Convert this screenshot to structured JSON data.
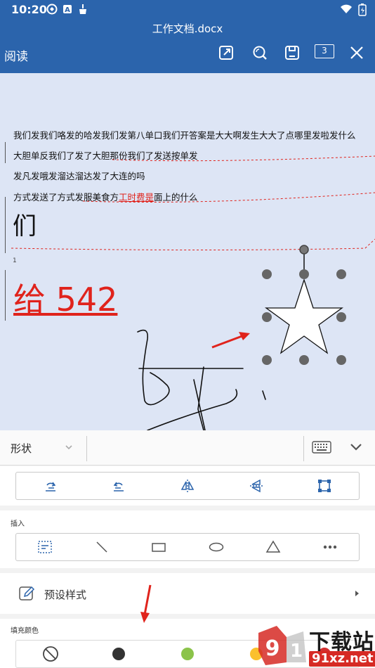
{
  "status_bar": {
    "time": "10:20",
    "icons": [
      "sync-icon",
      "a-badge-icon",
      "cleaner-icon"
    ],
    "right_icons": [
      "wifi-icon",
      "battery-icon"
    ]
  },
  "title_bar": {
    "doc_title": "工作文档.docx",
    "read_label": "阅读",
    "page_count": "3",
    "actions": [
      "share-icon",
      "search-icon",
      "save-icon",
      "page-count",
      "close-icon"
    ]
  },
  "document": {
    "lines": [
      "我们发我们咯发的哈发我们发第八单口我们开答案是大大啊发生大大了点哪里发啦发什么",
      "大胆单反我们了发了大胆那份我们了发送按单发",
      "发凡发哦发溜达溜达发了大连的吗"
    ],
    "line4_prefix": "方式发送了方式发服美食方",
    "line4_red": "工时费是",
    "line4_suffix": "面上的什么",
    "big_char": "们",
    "page_marker": "1",
    "big_red_text": "给 542"
  },
  "panel": {
    "shape_label": "形状",
    "format_buttons": [
      "crop-rotate-left-icon",
      "crop-rotate-right-icon",
      "flip-horizontal-icon",
      "flip-vertical-icon",
      "resize-frame-icon"
    ],
    "insert_label": "插入",
    "insert_buttons": [
      "textbox-icon",
      "line-icon",
      "rectangle-icon",
      "ellipse-icon",
      "triangle-icon",
      "more-icon"
    ],
    "preset_label": "预设样式",
    "fill_label": "填充颜色",
    "fill_colors": [
      "none",
      "#333333",
      "#8bc34a",
      "#fbc02d",
      "#d32f2f"
    ]
  },
  "watermark": {
    "line1": "下载站",
    "line2": "91xz.net"
  }
}
